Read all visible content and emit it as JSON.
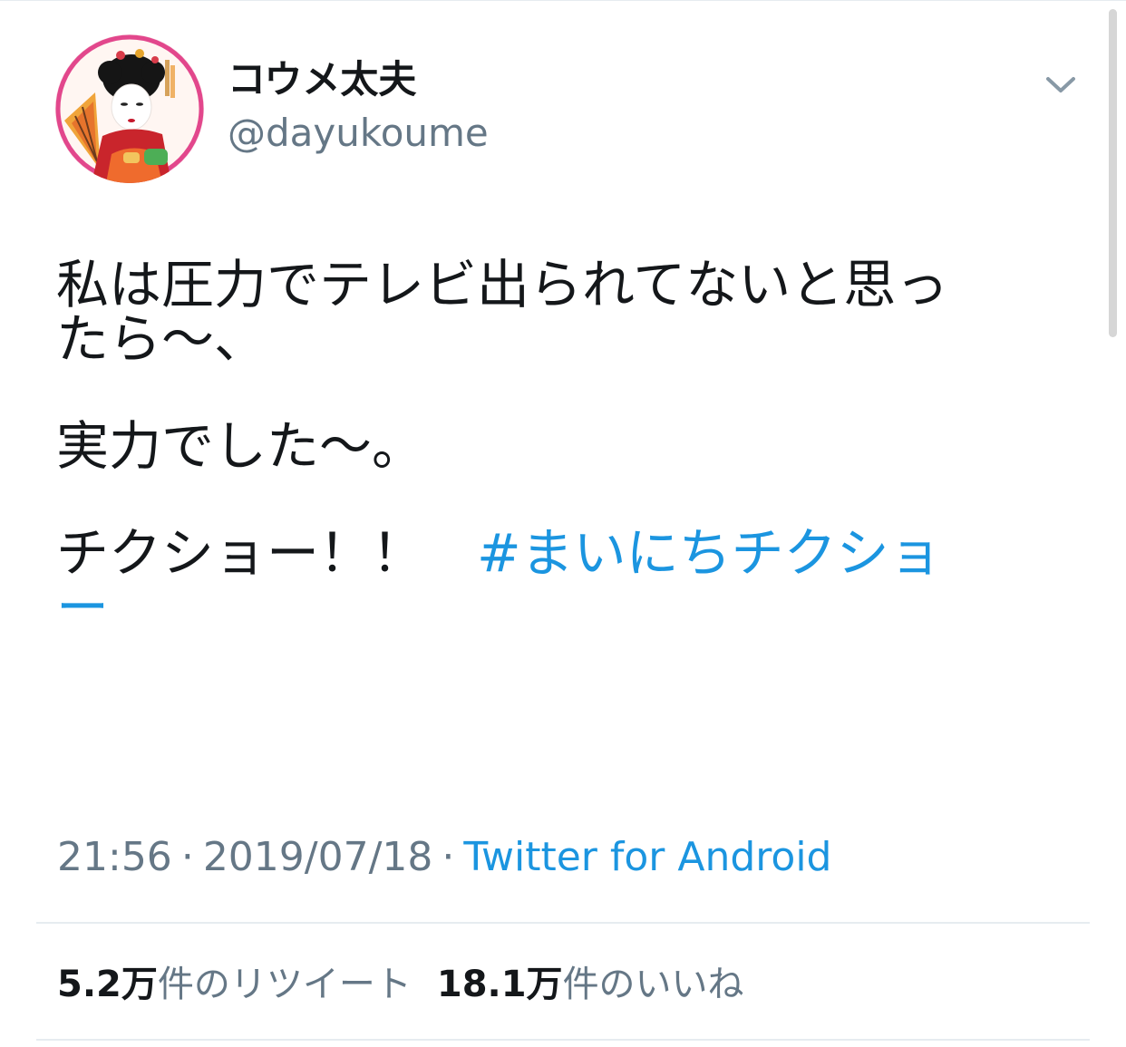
{
  "tweet": {
    "display_name": "コウメ太夫",
    "handle": "@dayukoume",
    "text_lines": [
      "私は圧力でテレビ出られてないと思っ",
      "たら〜、",
      "実力でした〜。",
      "チクショー！！　"
    ],
    "hashtag_part1": "#まいにちチクショ",
    "hashtag_part2": "ー",
    "time": "21:56",
    "separator": "·",
    "date": "2019/07/18",
    "source": "Twitter for Android"
  },
  "stats": {
    "retweets_count": "5.2万",
    "retweets_label": "件のリツイート",
    "likes_count": "18.1万",
    "likes_label": "件のいいね"
  },
  "icons": {
    "menu": "chevron-down-icon",
    "avatar": "avatar-image"
  },
  "colors": {
    "text": "#14171a",
    "secondary": "#657786",
    "link": "#1b95e0",
    "divider": "#e6ecf0"
  }
}
